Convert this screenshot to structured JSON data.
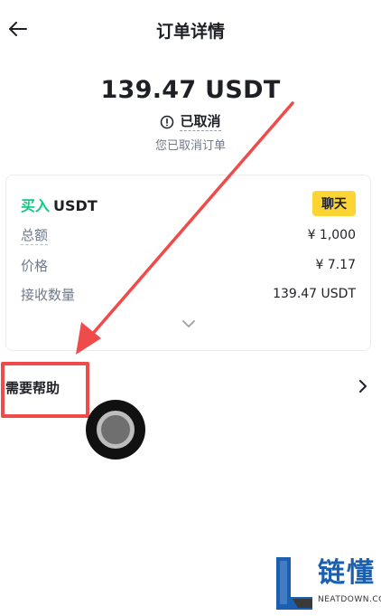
{
  "header": {
    "title": "订单详情",
    "back_icon": "arrow-left-icon"
  },
  "order": {
    "amount": "139.47 USDT",
    "status": "已取消",
    "status_icon": "info-circle-icon",
    "status_subtitle": "您已取消订单"
  },
  "card": {
    "side": "买入",
    "asset": "USDT",
    "chat_label": "聊天",
    "rows": [
      {
        "label": "总额",
        "value": "¥ 1,000"
      },
      {
        "label": "价格",
        "value": "¥ 7.17"
      },
      {
        "label": "接收数量",
        "value": "139.47 USDT"
      }
    ],
    "expand_icon": "chevron-down-icon"
  },
  "help": {
    "label": "需要帮助",
    "chevron_icon": "chevron-right-icon"
  },
  "watermark": {
    "title": "链懂",
    "subtitle": "NEATDOWN.COM"
  },
  "colors": {
    "buy_green": "#0ecb81",
    "chat_yellow": "#fcd535",
    "annotation_red": "#ef4b4b",
    "text_primary": "#1e2026",
    "text_secondary": "#707a8a"
  }
}
